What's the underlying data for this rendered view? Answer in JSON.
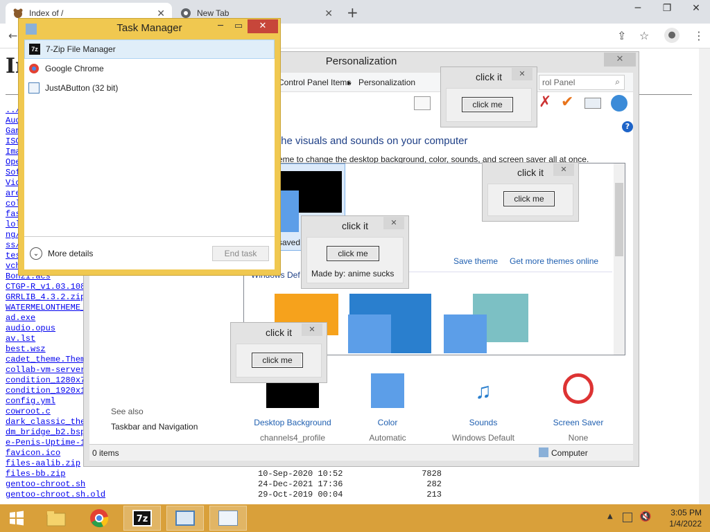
{
  "browser": {
    "tabs": [
      {
        "label": "Index of /",
        "active": true
      },
      {
        "label": "New Tab",
        "active": false
      }
    ],
    "new_tab": "+",
    "window": {
      "minimize": "─",
      "restore": "❐",
      "close": "✕"
    }
  },
  "page": {
    "heading": "In",
    "entries": [
      "../",
      "Aud",
      "Gam",
      "ISO",
      "Ima",
      "Ope",
      "Sof",
      "Vid",
      "are",
      "col",
      "fas",
      "lol",
      "ng/",
      "ss/",
      "tes",
      "vch",
      "Bonzi.acs",
      "CTGP-R_v1.03.108",
      "GRRLIB_4.3.2.zip",
      "WATERMELONTHEME_",
      "ad.exe",
      "audio.opus",
      "av.lst",
      "best.wsz",
      "cadet_theme.Them",
      "collab-vm-server",
      "condition_1280x7",
      "condition_1920x1",
      "config.yml",
      "cowroot.c",
      "dark_classic_the",
      "dm_bridge_b2.bsp",
      "e-Penis-Uptime-1",
      "favicon.ico",
      "files-aalib.zip"
    ],
    "rows": [
      {
        "name": "files-bb.zip",
        "date": "10-Sep-2020 10:52",
        "size": "7828"
      },
      {
        "name": "gentoo-chroot.sh",
        "date": "24-Dec-2021 17:36",
        "size": "282"
      },
      {
        "name": "gentoo-chroot.sh.old",
        "date": "29-Oct-2019 00:04",
        "size": "213"
      }
    ]
  },
  "personalization": {
    "title": "Personalization",
    "breadcrumb": [
      "Control Panel Items",
      "Personalization"
    ],
    "search_placeholder": "rol Panel",
    "heading": "the visuals and sounds on your computer",
    "subheading": "eme to change the desktop background, color, sounds, and screen saver all at once.",
    "saved_label": "saved",
    "save_theme": "Save theme",
    "get_more": "Get more themes online",
    "windows_default": "Windows Def",
    "see_also": "See also",
    "taskbar_nav": "Taskbar and Navigation",
    "items": [
      {
        "caption": "Desktop Background",
        "value": "channels4_profile"
      },
      {
        "caption": "Color",
        "value": "Automatic"
      },
      {
        "caption": "Sounds",
        "value": "Windows Default"
      },
      {
        "caption": "Screen Saver",
        "value": "None"
      }
    ],
    "status_items": "0 items",
    "status_location": "Computer"
  },
  "task_manager": {
    "title": "Task Manager",
    "apps": [
      {
        "name": "7-Zip File Manager",
        "icon": "7z-icon"
      },
      {
        "name": "Google Chrome",
        "icon": "chrome-icon"
      },
      {
        "name": "JustAButton (32 bit)",
        "icon": "app-icon"
      }
    ],
    "more_details": "More details",
    "end_task": "End task"
  },
  "popups": [
    {
      "title": "click it",
      "button": "click me",
      "note": ""
    },
    {
      "title": "click it",
      "button": "click me",
      "note": ""
    },
    {
      "title": "click it",
      "button": "click me",
      "note": "Made by: anime sucks"
    },
    {
      "title": "click it",
      "button": "click me",
      "note": ""
    }
  ],
  "taskbar": {
    "time": "3:05 PM",
    "date": "1/4/2022",
    "color": "#d9a03a"
  }
}
